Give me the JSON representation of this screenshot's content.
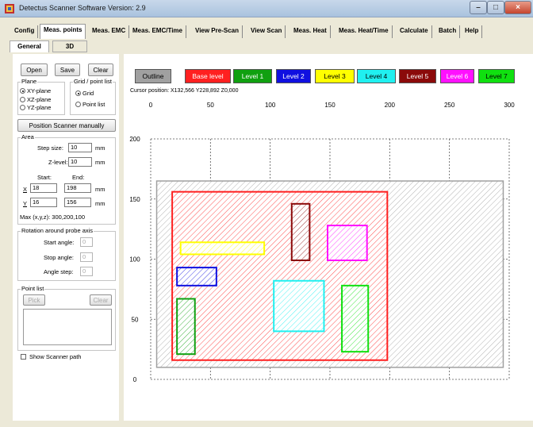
{
  "window": {
    "title": "Detectus Scanner Software Version: 2.9",
    "app_icon": "detectus-app-icon",
    "controls": {
      "minimize": "–",
      "maximize": "□",
      "close": "×"
    }
  },
  "menu_tabs": [
    "Config",
    "Meas. points",
    "Meas. EMC",
    "Meas. EMC/Time",
    "View Pre-Scan",
    "View Scan",
    "Meas. Heat",
    "Meas. Heat/Time",
    "Calculate",
    "Batch",
    "Help"
  ],
  "active_menu_tab": "Meas. points",
  "sub_tabs": [
    "General",
    "3D"
  ],
  "active_sub_tab": "General",
  "file_buttons": {
    "open": "Open",
    "save": "Save",
    "clear": "Clear"
  },
  "plane": {
    "label": "Plane",
    "options": [
      "XY-plane",
      "XZ-plane",
      "YZ-plane"
    ],
    "selected": "XY-plane"
  },
  "grid_point": {
    "label": "Grid / point list",
    "options": [
      "Grid",
      "Point list"
    ],
    "selected": "Grid"
  },
  "position_button": "Position Scanner manually",
  "area": {
    "label": "Area",
    "step_size_label": "Step size:",
    "step_size": "10",
    "z_level_label": "Z-level:",
    "z_level": "10",
    "unit": "mm",
    "start_label": "Start:",
    "end_label": "End:",
    "x_label": "X",
    "x_start": "18",
    "x_end": "198",
    "y_label": "Y",
    "y_start": "16",
    "y_end": "156",
    "max_text": "Max (x,y,z): 300,200,100"
  },
  "rotation": {
    "label": "Rotation around probe axis",
    "start_angle_label": "Start angle:",
    "start_angle": "0",
    "stop_angle_label": "Stop angle:",
    "stop_angle": "0",
    "angle_step_label": "Angle step:",
    "angle_step": "0"
  },
  "point_list": {
    "label": "Point list",
    "pick": "Pick",
    "clear": "Clear"
  },
  "show_scanner_path": "Show Scanner path",
  "levels": [
    {
      "label": "Outline",
      "bg": "#a0a0a0",
      "fg": "#000000"
    },
    {
      "label": "Base level",
      "bg": "#ff2020",
      "fg": "#ffffff"
    },
    {
      "label": "Level 1",
      "bg": "#10a010",
      "fg": "#ffffff"
    },
    {
      "label": "Level 2",
      "bg": "#1010e0",
      "fg": "#ffffff"
    },
    {
      "label": "Level 3",
      "bg": "#ffff00",
      "fg": "#000000"
    },
    {
      "label": "Level 4",
      "bg": "#20f0f0",
      "fg": "#000000"
    },
    {
      "label": "Level 5",
      "bg": "#8b0a0a",
      "fg": "#ffffff"
    },
    {
      "label": "Level 6",
      "bg": "#ff10ff",
      "fg": "#ffffff"
    },
    {
      "label": "Level 7",
      "bg": "#10e010",
      "fg": "#000000"
    }
  ],
  "cursor_position": "Cursor position: X132,566 Y228,892 Z0,000",
  "plot": {
    "x_ticks": [
      "0",
      "50",
      "100",
      "150",
      "200",
      "250",
      "300"
    ],
    "y_ticks": [
      "200",
      "150",
      "100",
      "50",
      "0"
    ],
    "x_values": [
      0,
      50,
      100,
      150,
      200,
      250,
      300
    ],
    "y_values": [
      200,
      150,
      100,
      50,
      0
    ],
    "x_range": [
      0,
      300
    ],
    "y_range": [
      0,
      200
    ],
    "dashed_region": {
      "x": [
        0,
        300
      ],
      "y": [
        0,
        200
      ]
    },
    "outline": {
      "x": [
        5,
        295
      ],
      "y": [
        10,
        165
      ],
      "color": "#a0a0a0"
    },
    "base": {
      "x": [
        18,
        198
      ],
      "y": [
        16,
        156
      ],
      "color": "#ff2020"
    },
    "shapes": [
      {
        "name": "level-3-rect",
        "x": [
          25,
          95
        ],
        "y": [
          104,
          114
        ],
        "color": "#ffff00"
      },
      {
        "name": "level-2-rect",
        "x": [
          22,
          55
        ],
        "y": [
          78,
          93
        ],
        "color": "#1010e0"
      },
      {
        "name": "level-1-rect",
        "x": [
          22,
          37
        ],
        "y": [
          21,
          67
        ],
        "color": "#10a010"
      },
      {
        "name": "level-4-rect",
        "x": [
          103,
          145
        ],
        "y": [
          40,
          82
        ],
        "color": "#20f0f0"
      },
      {
        "name": "level-5-rect",
        "x": [
          118,
          133
        ],
        "y": [
          99,
          146
        ],
        "color": "#8b0a0a"
      },
      {
        "name": "level-6-rect",
        "x": [
          148,
          181
        ],
        "y": [
          99,
          128
        ],
        "color": "#ff10ff"
      },
      {
        "name": "level-7-rect",
        "x": [
          160,
          182
        ],
        "y": [
          23,
          78
        ],
        "color": "#10e010"
      }
    ]
  }
}
